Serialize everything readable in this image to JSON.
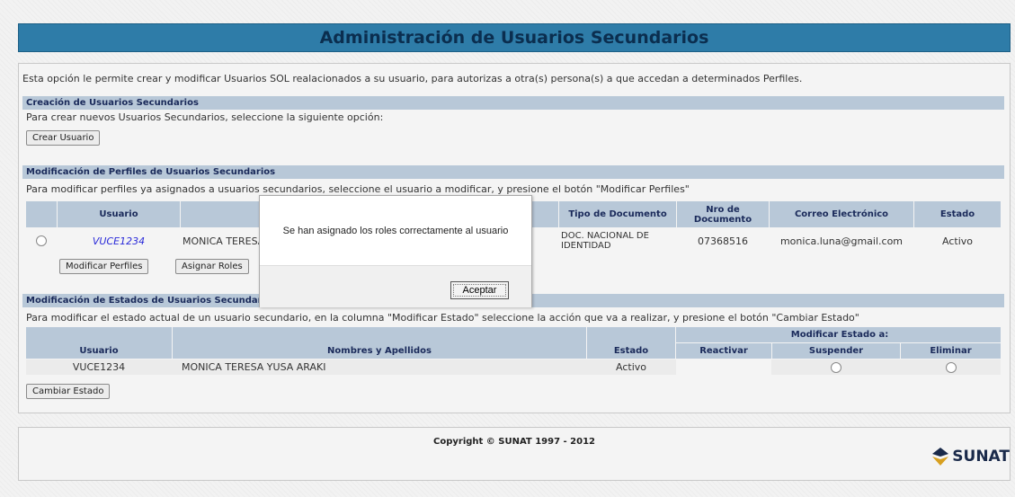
{
  "title": "Administración de Usuarios Secundarios",
  "intro": "Esta opción le permite crear y modificar Usuarios SOL realacionados a su usuario, para autorizas a otra(s) persona(s) a que accedan a determinados Perfiles.",
  "creacion": {
    "heading": "Creación de Usuarios Secundarios",
    "text": "Para crear nuevos Usuarios Secundarios, seleccione la siguiente opción:",
    "button": "Crear Usuario"
  },
  "perfiles": {
    "heading": "Modificación de Perfiles de Usuarios Secundarios",
    "text": "Para modificar perfiles ya asignados a usuarios secundarios, seleccione el usuario a modificar, y presione el botón \"Modificar Perfiles\"",
    "columns": {
      "usuario": "Usuario",
      "tipo": "Tipo de Documento",
      "nro": "Nro de Documento",
      "correo": "Correo Electrónico",
      "estado": "Estado"
    },
    "row": {
      "usuario": "VUCE1234",
      "nombre": "MONICA TERESA YUSA ARAKI",
      "tipo": "DOC. NACIONAL DE IDENTIDAD",
      "nro": "07368516",
      "correo": "monica.luna@gmail.com",
      "estado": "Activo"
    },
    "btn_modificar": "Modificar Perfiles",
    "btn_asignar": "Asignar Roles"
  },
  "estados": {
    "heading": "Modificación de Estados de Usuarios Secundarios",
    "text": "Para modificar el estado actual de un usuario secundario, en la columna \"Modificar Estado\" seleccione la acción que va a realizar, y presione el botón \"Cambiar Estado\"",
    "columns": {
      "usuario": "Usuario",
      "nombres": "Nombres y Apellidos",
      "estado": "Estado",
      "modificar": "Modificar Estado a:",
      "reactivar": "Reactivar",
      "suspender": "Suspender",
      "eliminar": "Eliminar"
    },
    "row": {
      "usuario": "VUCE1234",
      "nombres": "MONICA TERESA  YUSA ARAKI",
      "estado": "Activo"
    },
    "button": "Cambiar Estado"
  },
  "footer": {
    "copyright": "Copyright © SUNAT 1997 - 2012",
    "logo": "SUNAT"
  },
  "dialog": {
    "message": "Se han asignado los roles correctamente al usuario",
    "ok": "Aceptar"
  }
}
